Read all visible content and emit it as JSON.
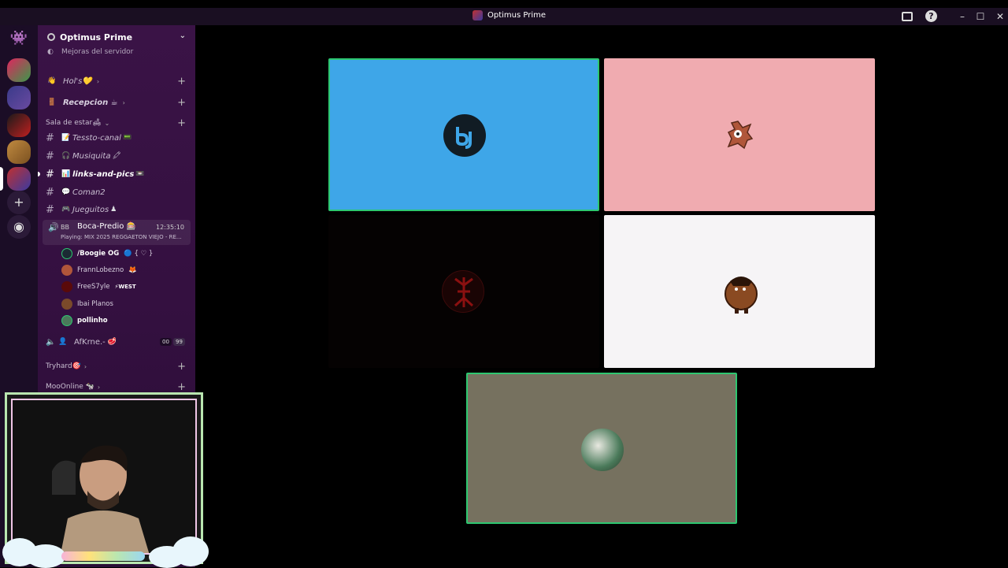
{
  "window": {
    "title": "Optimus Prime"
  },
  "server": {
    "name": "Optimus Prime",
    "boost_label": "Mejoras del servidor"
  },
  "categories": [
    {
      "label": "Hol's💛"
    },
    {
      "label": "Recepcion ☕"
    },
    {
      "label": "Sala de estar🛋"
    },
    {
      "label": "Tryhard🎯"
    },
    {
      "label": "MooOnline 🐄"
    }
  ],
  "text_channels": [
    {
      "emoji": "📝",
      "name": "Tessto-canal",
      "suffix": "📟"
    },
    {
      "emoji": "🎧",
      "name": "Musiquita",
      "suffix": "🖍"
    },
    {
      "emoji": "📊",
      "name": "links-and-pics",
      "suffix": "📼"
    },
    {
      "emoji": "💬",
      "name": "Coman2",
      "suffix": ""
    },
    {
      "emoji": "🎮",
      "name": "Jueguitos",
      "suffix": "♟"
    }
  ],
  "voice_channel": {
    "prefix": "BB",
    "name": "Boca-Predio 🎰",
    "timer": "12:35:10",
    "activity": "Playing: MIX 2025 REGGAETON VIEJO - RE..."
  },
  "members": [
    {
      "name": "/Boogie OG",
      "tag": "🔵 { ♡ }",
      "color": "#4a9be0"
    },
    {
      "name": "FrannLobezno",
      "tag": "🦊",
      "color": "#b0563a"
    },
    {
      "name": "FreeS7yle",
      "tag": "⚡WEST",
      "color": "#5a0a0a"
    },
    {
      "name": "Ibai Planos",
      "tag": "",
      "color": "#7a4a2a"
    },
    {
      "name": "pollinho",
      "tag": "",
      "color": "#4a7a5a"
    }
  ],
  "afk_channel": {
    "name": "AfKrne.-",
    "emoji": "🥩",
    "count": "00",
    "limit": "99"
  },
  "colors": {
    "speaking": "#2dc770",
    "tile_blue": "#3ea6e8",
    "tile_pink": "#f0abb0",
    "tile_dark": "#050202",
    "tile_white": "#f6f4f6",
    "tile_olive": "#76715f"
  }
}
